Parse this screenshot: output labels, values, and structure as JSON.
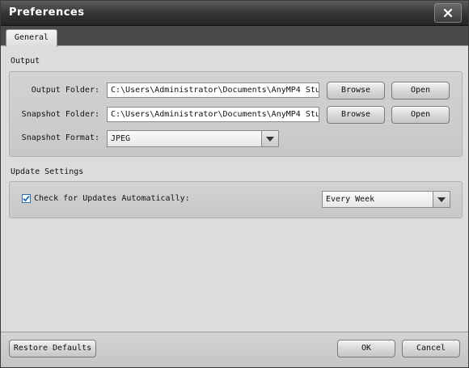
{
  "window": {
    "title": "Preferences"
  },
  "tabs": [
    {
      "label": "General"
    }
  ],
  "output": {
    "section_label": "Output",
    "output_folder": {
      "label": "Output Folder:",
      "value": "C:\\Users\\Administrator\\Documents\\AnyMP4 Stu",
      "browse_label": "Browse",
      "open_label": "Open"
    },
    "snapshot_folder": {
      "label": "Snapshot Folder:",
      "value": "C:\\Users\\Administrator\\Documents\\AnyMP4 Stu",
      "browse_label": "Browse",
      "open_label": "Open"
    },
    "snapshot_format": {
      "label": "Snapshot Format:",
      "value": "JPEG"
    }
  },
  "update": {
    "section_label": "Update Settings",
    "check_label": "Check for Updates Automatically:",
    "checked": true,
    "frequency": "Every Week"
  },
  "footer": {
    "restore_label": "Restore Defaults",
    "ok_label": "OK",
    "cancel_label": "Cancel"
  },
  "icons": {
    "close": "close-icon",
    "dropdown": "dropdown-arrow-icon",
    "checkmark": "checkmark-icon"
  },
  "colors": {
    "titlebar": "#333333",
    "checkbox_accent": "#2b6cb0"
  }
}
